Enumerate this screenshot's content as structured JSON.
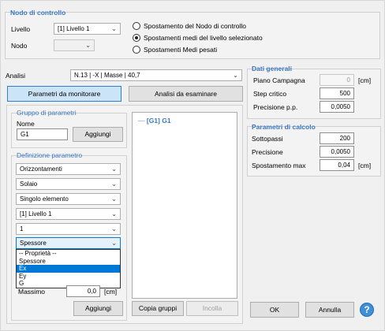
{
  "control_node": {
    "title": "Nodo di controllo",
    "livello_label": "Livello",
    "livello_value": "[1] Livello 1",
    "nodo_label": "Nodo",
    "nodo_value": "",
    "radio_options": [
      "Spostamento del Nodo di controllo",
      "Spostamenti medi del livello selezionato",
      "Spostamenti Medi pesati"
    ],
    "selected_radio": 1
  },
  "analisi": {
    "label": "Analisi",
    "value": "N.13 | -X | Masse | 40,7"
  },
  "tabs": {
    "monitor": "Parametri da monitorare",
    "examine": "Analisi da esaminare"
  },
  "gruppo": {
    "title": "Gruppo di parametri",
    "nome_label": "Nome",
    "nome_value": "G1",
    "aggiungi": "Aggiungi"
  },
  "definizione": {
    "title": "Definizione parametro",
    "combos": [
      "Orizzontamenti",
      "Solaio",
      "Singolo elemento",
      "[1] Livello 1",
      "1",
      "Spessore"
    ],
    "dropdown_items": [
      "-- Proprietà --",
      "Spessore",
      "Ex",
      "Ey",
      "G"
    ],
    "dropdown_selected": 2,
    "massimo_label": "Massimo",
    "massimo_value": "0,0",
    "massimo_unit": "[cm]",
    "aggiungi": "Aggiungi"
  },
  "tree": {
    "item": "[G1] G1"
  },
  "bottom_buttons": {
    "copia": "Copia gruppi",
    "incolla": "Incolla",
    "ok": "OK",
    "annulla": "Annulla"
  },
  "dati_generali": {
    "title": "Dati generali",
    "rows": [
      {
        "label": "Piano Campagna",
        "value": "0",
        "unit": "[cm]"
      },
      {
        "label": "Step critico",
        "value": "500",
        "unit": ""
      },
      {
        "label": "Precisione p.p.",
        "value": "0,0050",
        "unit": ""
      }
    ]
  },
  "parametri_calcolo": {
    "title": "Parametri di calcolo",
    "rows": [
      {
        "label": "Sottopassi",
        "value": "200",
        "unit": ""
      },
      {
        "label": "Precisione",
        "value": "0,0050",
        "unit": ""
      },
      {
        "label": "Spostamento max",
        "value": "0,04",
        "unit": "[cm]"
      }
    ]
  },
  "colors": {
    "accent": "#3a78c2",
    "selection": "#0078d7",
    "tab_active": "#cce4f7"
  }
}
